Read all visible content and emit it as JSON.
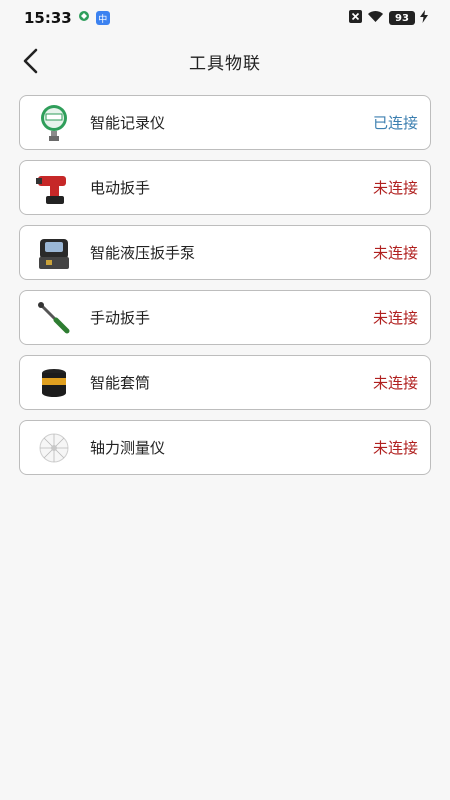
{
  "status_bar": {
    "time": "15:33",
    "battery": "93",
    "icons": [
      "app-notification-icon",
      "app-badge-icon",
      "close-box-icon",
      "wifi-icon",
      "battery-icon",
      "charging-icon"
    ]
  },
  "header": {
    "title": "工具物联",
    "back_icon": "back-arrow-icon"
  },
  "colors": {
    "connected": "#3c7fb0",
    "disconnected": "#b0201f",
    "background": "#f7f7f7"
  },
  "devices": [
    {
      "name": "智能记录仪",
      "status": "已连接",
      "connected": true,
      "icon": "smart-recorder-icon"
    },
    {
      "name": "电动扳手",
      "status": "未连接",
      "connected": false,
      "icon": "electric-wrench-icon"
    },
    {
      "name": "智能液压扳手泵",
      "status": "未连接",
      "connected": false,
      "icon": "hydraulic-pump-icon"
    },
    {
      "name": "手动扳手",
      "status": "未连接",
      "connected": false,
      "icon": "manual-wrench-icon"
    },
    {
      "name": "智能套筒",
      "status": "未连接",
      "connected": false,
      "icon": "smart-socket-icon"
    },
    {
      "name": "轴力测量仪",
      "status": "未连接",
      "connected": false,
      "icon": "axial-force-meter-icon"
    }
  ]
}
